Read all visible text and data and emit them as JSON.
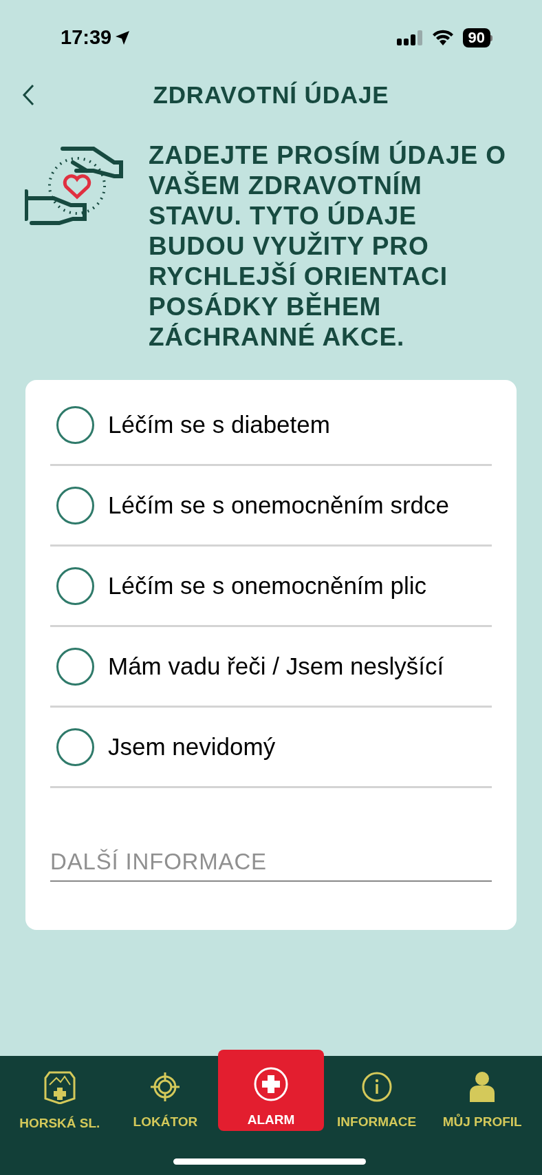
{
  "status_bar": {
    "time": "17:39",
    "battery": "90"
  },
  "header": {
    "title": "ZDRAVOTNÍ ÚDAJE"
  },
  "intro": {
    "text": "ZADEJTE PROSÍM ÚDAJE O VAŠEM ZDRAVOTNÍM STAVU. TYTO ÚDAJE BUDOU VYUŽITY PRO RYCHLEJŠÍ ORIENTACI POSÁDKY BĚHEM ZÁCHRANNÉ AKCE."
  },
  "options": [
    {
      "label": "Léčím se s diabetem",
      "checked": false
    },
    {
      "label": "Léčím se s onemocněním srdce",
      "checked": false
    },
    {
      "label": "Léčím se s onemocněním plic",
      "checked": false
    },
    {
      "label": "Mám vadu řeči / Jsem neslyšící",
      "checked": false
    },
    {
      "label": "Jsem nevidomý",
      "checked": false
    }
  ],
  "additional_info": {
    "placeholder": "DALŠÍ INFORMACE"
  },
  "tab_bar": [
    {
      "kind": "emblem",
      "label": "HORSKÁ SL."
    },
    {
      "kind": "locator",
      "label": "LOKÁTOR"
    },
    {
      "kind": "alarm",
      "label": "ALARM"
    },
    {
      "kind": "info",
      "label": "INFORMACE"
    },
    {
      "kind": "profile",
      "label": "MŮJ PROFIL"
    }
  ]
}
